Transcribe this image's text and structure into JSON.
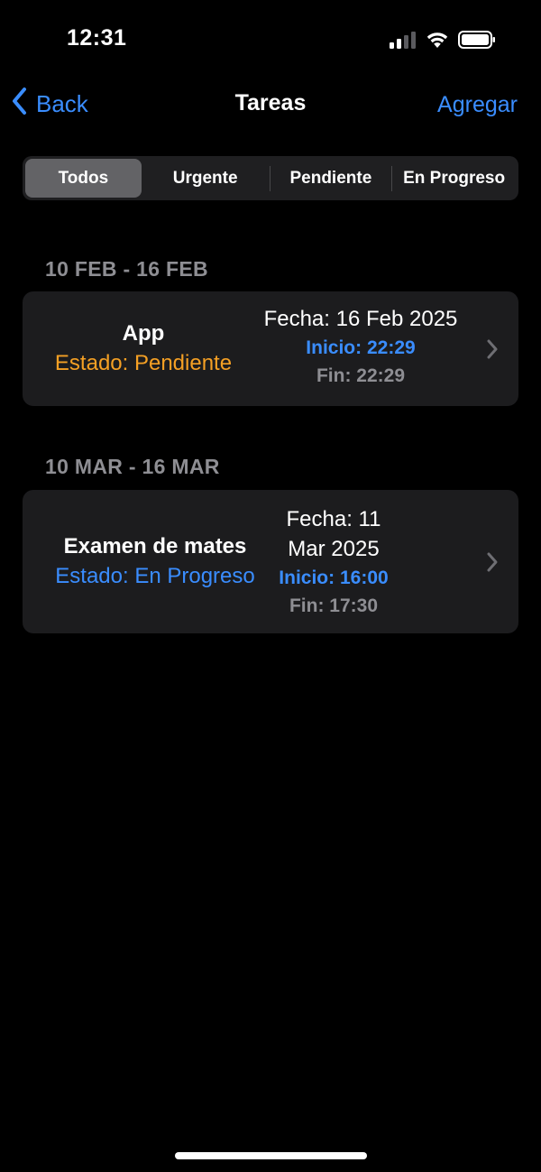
{
  "status_bar": {
    "time": "12:31",
    "icons": [
      "cellular-signal-icon",
      "wifi-icon",
      "battery-icon"
    ]
  },
  "nav": {
    "back_label": "Back",
    "title": "Tareas",
    "add_label": "Agregar"
  },
  "filters": {
    "selected": "Todos",
    "options": [
      "Todos",
      "Urgente",
      "Pendiente",
      "En Progreso"
    ]
  },
  "sections": [
    {
      "header": "10 FEB - 16 FEB",
      "tasks": [
        {
          "name": "App",
          "status": "Estado: Pendiente",
          "date": "Fecha: 16 Feb 2025",
          "start": "Inicio: 22:29",
          "end": "Fin: 22:29"
        }
      ]
    },
    {
      "header": "10 MAR - 16 MAR",
      "tasks": [
        {
          "name": "Examen de mates",
          "status": "Estado: En Progreso",
          "date_line1": "Fecha: 11",
          "date_line2": "Mar 2025",
          "start": "Inicio: 16:00",
          "end": "Fin: 17:30"
        }
      ]
    }
  ],
  "colors": {
    "accent": "#3a8dff",
    "pending": "#f5a024",
    "in_progress": "#3a8dff",
    "card_background": "#1c1c1e",
    "secondary_text": "#8e8e93"
  }
}
